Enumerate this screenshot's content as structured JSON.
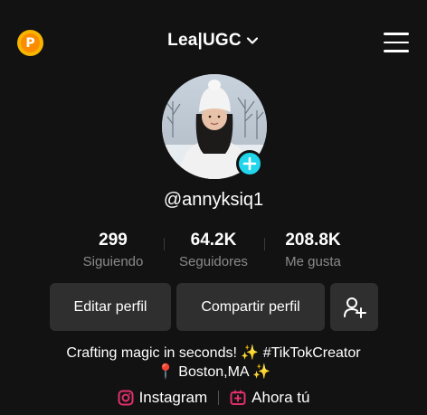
{
  "header": {
    "coin_letter": "P",
    "account_name": "Lea|UGC",
    "icons": {
      "coin": "coin-icon",
      "chevron": "chevron-down-icon",
      "menu": "hamburger-menu-icon"
    }
  },
  "profile": {
    "handle": "@annyksiq1"
  },
  "stats": [
    {
      "value": "299",
      "label": "Siguiendo"
    },
    {
      "value": "64.2K",
      "label": "Seguidores"
    },
    {
      "value": "208.8K",
      "label": "Me gusta"
    }
  ],
  "actions": {
    "edit_label": "Editar perfil",
    "share_label": "Compartir perfil",
    "add_friend_icon": "add-user-icon"
  },
  "bio": {
    "line1": "Crafting magic in seconds! ✨ #TikTokCreator",
    "line2": "📍 Boston,MA ✨"
  },
  "links": {
    "instagram_label": "Instagram",
    "second_label": "Ahora tú"
  },
  "colors": {
    "background": "#121212",
    "button_bg": "#2f2f2f",
    "badge": "#20d5ec",
    "instagram": "#e1306c",
    "coin": "#f7b500"
  }
}
